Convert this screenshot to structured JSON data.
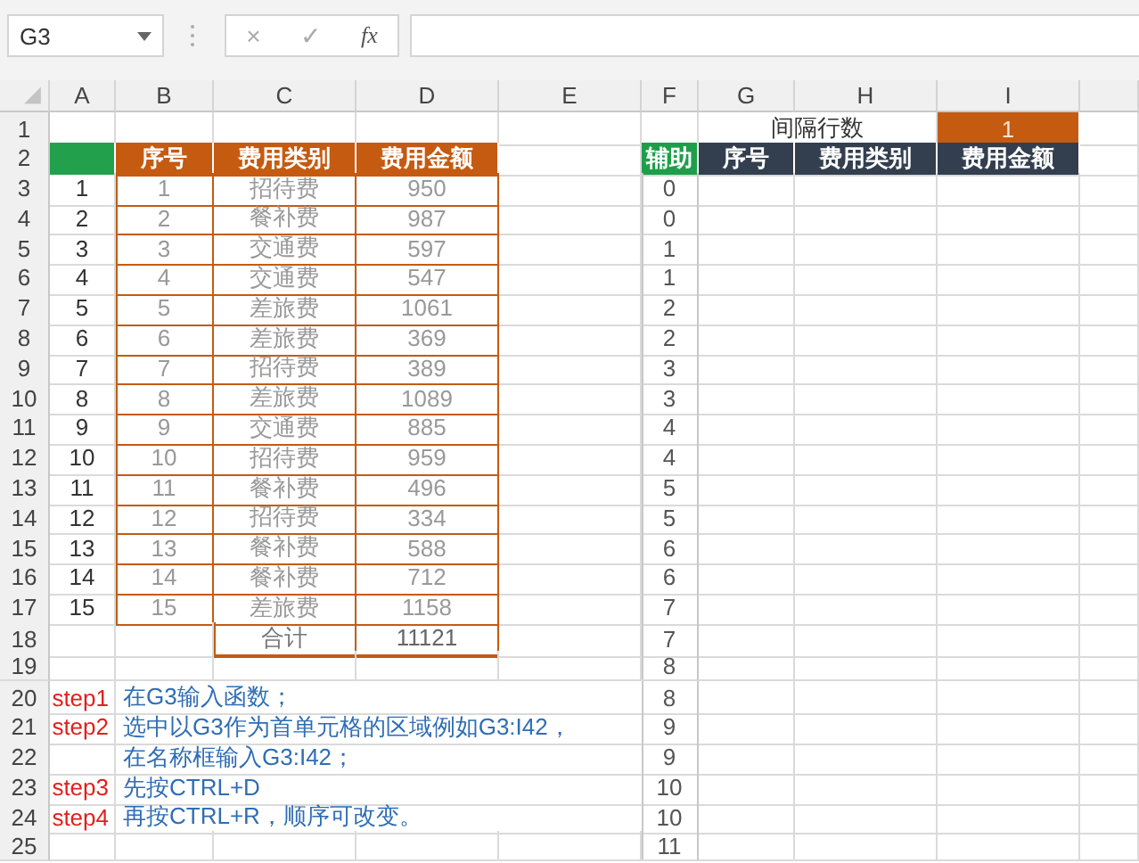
{
  "name_box": "G3",
  "formula_buttons": {
    "cancel": "×",
    "enter": "✓",
    "function": "fx"
  },
  "columns": [
    "A",
    "B",
    "C",
    "D",
    "E",
    "F",
    "G",
    "H",
    "I"
  ],
  "rows": [
    {
      "number": "1",
      "cells": {
        "G": {
          "kind": "label",
          "text": "间隔行数"
        },
        "I": {
          "kind": "orange_value",
          "text": "1"
        }
      }
    },
    {
      "number": "2",
      "cells": {
        "A": {
          "kind": "green_fill"
        },
        "B": {
          "kind": "orange_header",
          "text": "序号"
        },
        "C": {
          "kind": "orange_header",
          "text": "费用类别"
        },
        "D": {
          "kind": "orange_header",
          "text": "费用金额"
        },
        "F": {
          "kind": "helper_header",
          "text": "辅助"
        },
        "G": {
          "kind": "dark_header",
          "text": "序号"
        },
        "H": {
          "kind": "dark_header",
          "text": "费用类别"
        },
        "I": {
          "kind": "dark_header",
          "text": "费用金额"
        }
      }
    },
    {
      "number": "3",
      "cells": {
        "A": {
          "kind": "index",
          "text": "1"
        },
        "B": {
          "kind": "data",
          "text": "1"
        },
        "C": {
          "kind": "data",
          "text": "招待费"
        },
        "D": {
          "kind": "data",
          "text": "950"
        },
        "F": {
          "kind": "helper",
          "text": "0"
        }
      }
    },
    {
      "number": "4",
      "cells": {
        "A": {
          "kind": "index",
          "text": "2"
        },
        "B": {
          "kind": "data",
          "text": "2"
        },
        "C": {
          "kind": "data",
          "text": "餐补费"
        },
        "D": {
          "kind": "data",
          "text": "987"
        },
        "F": {
          "kind": "helper",
          "text": "0"
        }
      }
    },
    {
      "number": "5",
      "cells": {
        "A": {
          "kind": "index",
          "text": "3"
        },
        "B": {
          "kind": "data",
          "text": "3"
        },
        "C": {
          "kind": "data",
          "text": "交通费"
        },
        "D": {
          "kind": "data",
          "text": "597"
        },
        "F": {
          "kind": "helper",
          "text": "1"
        }
      }
    },
    {
      "number": "6",
      "cells": {
        "A": {
          "kind": "index",
          "text": "4"
        },
        "B": {
          "kind": "data",
          "text": "4"
        },
        "C": {
          "kind": "data",
          "text": "交通费"
        },
        "D": {
          "kind": "data",
          "text": "547"
        },
        "F": {
          "kind": "helper",
          "text": "1"
        }
      }
    },
    {
      "number": "7",
      "cells": {
        "A": {
          "kind": "index",
          "text": "5"
        },
        "B": {
          "kind": "data",
          "text": "5"
        },
        "C": {
          "kind": "data",
          "text": "差旅费"
        },
        "D": {
          "kind": "data",
          "text": "1061"
        },
        "F": {
          "kind": "helper",
          "text": "2"
        }
      }
    },
    {
      "number": "8",
      "cells": {
        "A": {
          "kind": "index",
          "text": "6"
        },
        "B": {
          "kind": "data",
          "text": "6"
        },
        "C": {
          "kind": "data",
          "text": "差旅费"
        },
        "D": {
          "kind": "data",
          "text": "369"
        },
        "F": {
          "kind": "helper",
          "text": "2"
        }
      }
    },
    {
      "number": "9",
      "cells": {
        "A": {
          "kind": "index",
          "text": "7"
        },
        "B": {
          "kind": "data",
          "text": "7"
        },
        "C": {
          "kind": "data",
          "text": "招待费"
        },
        "D": {
          "kind": "data",
          "text": "389"
        },
        "F": {
          "kind": "helper",
          "text": "3"
        }
      }
    },
    {
      "number": "10",
      "cells": {
        "A": {
          "kind": "index",
          "text": "8"
        },
        "B": {
          "kind": "data",
          "text": "8"
        },
        "C": {
          "kind": "data",
          "text": "差旅费"
        },
        "D": {
          "kind": "data",
          "text": "1089"
        },
        "F": {
          "kind": "helper",
          "text": "3"
        }
      }
    },
    {
      "number": "11",
      "cells": {
        "A": {
          "kind": "index",
          "text": "9"
        },
        "B": {
          "kind": "data",
          "text": "9"
        },
        "C": {
          "kind": "data",
          "text": "交通费"
        },
        "D": {
          "kind": "data",
          "text": "885"
        },
        "F": {
          "kind": "helper",
          "text": "4"
        }
      }
    },
    {
      "number": "12",
      "cells": {
        "A": {
          "kind": "index",
          "text": "10"
        },
        "B": {
          "kind": "data",
          "text": "10"
        },
        "C": {
          "kind": "data",
          "text": "招待费"
        },
        "D": {
          "kind": "data",
          "text": "959"
        },
        "F": {
          "kind": "helper",
          "text": "4"
        }
      }
    },
    {
      "number": "13",
      "cells": {
        "A": {
          "kind": "index",
          "text": "11"
        },
        "B": {
          "kind": "data",
          "text": "11"
        },
        "C": {
          "kind": "data",
          "text": "餐补费"
        },
        "D": {
          "kind": "data",
          "text": "496"
        },
        "F": {
          "kind": "helper",
          "text": "5"
        }
      }
    },
    {
      "number": "14",
      "cells": {
        "A": {
          "kind": "index",
          "text": "12"
        },
        "B": {
          "kind": "data",
          "text": "12"
        },
        "C": {
          "kind": "data",
          "text": "招待费"
        },
        "D": {
          "kind": "data",
          "text": "334"
        },
        "F": {
          "kind": "helper",
          "text": "5"
        }
      }
    },
    {
      "number": "15",
      "cells": {
        "A": {
          "kind": "index",
          "text": "13"
        },
        "B": {
          "kind": "data",
          "text": "13"
        },
        "C": {
          "kind": "data",
          "text": "餐补费"
        },
        "D": {
          "kind": "data",
          "text": "588"
        },
        "F": {
          "kind": "helper",
          "text": "6"
        }
      }
    },
    {
      "number": "16",
      "cells": {
        "A": {
          "kind": "index",
          "text": "14"
        },
        "B": {
          "kind": "data",
          "text": "14"
        },
        "C": {
          "kind": "data",
          "text": "餐补费"
        },
        "D": {
          "kind": "data",
          "text": "712"
        },
        "F": {
          "kind": "helper",
          "text": "6"
        }
      }
    },
    {
      "number": "17",
      "cells": {
        "A": {
          "kind": "index",
          "text": "15"
        },
        "B": {
          "kind": "data",
          "text": "15"
        },
        "C": {
          "kind": "data",
          "text": "差旅费"
        },
        "D": {
          "kind": "data",
          "text": "1158"
        },
        "F": {
          "kind": "helper",
          "text": "7"
        }
      }
    },
    {
      "number": "18",
      "cells": {
        "C": {
          "kind": "total_label",
          "text": "合计"
        },
        "D": {
          "kind": "total",
          "text": "11121"
        },
        "F": {
          "kind": "helper",
          "text": "7"
        }
      }
    },
    {
      "number": "19",
      "cells": {
        "F": {
          "kind": "helper",
          "text": "8"
        }
      }
    },
    {
      "number": "20",
      "cells": {
        "A": {
          "kind": "step",
          "text": "step1"
        },
        "B": {
          "kind": "note",
          "text": "在G3输入函数；"
        },
        "F": {
          "kind": "helper",
          "text": "8"
        }
      }
    },
    {
      "number": "21",
      "cells": {
        "A": {
          "kind": "step",
          "text": "step2"
        },
        "B": {
          "kind": "note",
          "text": "选中以G3作为首单元格的区域例如G3:I42，"
        },
        "F": {
          "kind": "helper",
          "text": "9"
        }
      }
    },
    {
      "number": "22",
      "cells": {
        "B": {
          "kind": "note",
          "text": "在名称框输入G3:I42；"
        },
        "F": {
          "kind": "helper",
          "text": "9"
        }
      }
    },
    {
      "number": "23",
      "cells": {
        "A": {
          "kind": "step",
          "text": "step3"
        },
        "B": {
          "kind": "note",
          "text": "先按CTRL+D"
        },
        "F": {
          "kind": "helper",
          "text": "10"
        }
      }
    },
    {
      "number": "24",
      "cells": {
        "A": {
          "kind": "step",
          "text": "step4"
        },
        "B": {
          "kind": "note",
          "text": "再按CTRL+R，顺序可改变。"
        },
        "F": {
          "kind": "helper",
          "text": "10"
        }
      }
    },
    {
      "number": "25",
      "cells": {
        "F": {
          "kind": "helper",
          "text": "11"
        }
      }
    }
  ]
}
